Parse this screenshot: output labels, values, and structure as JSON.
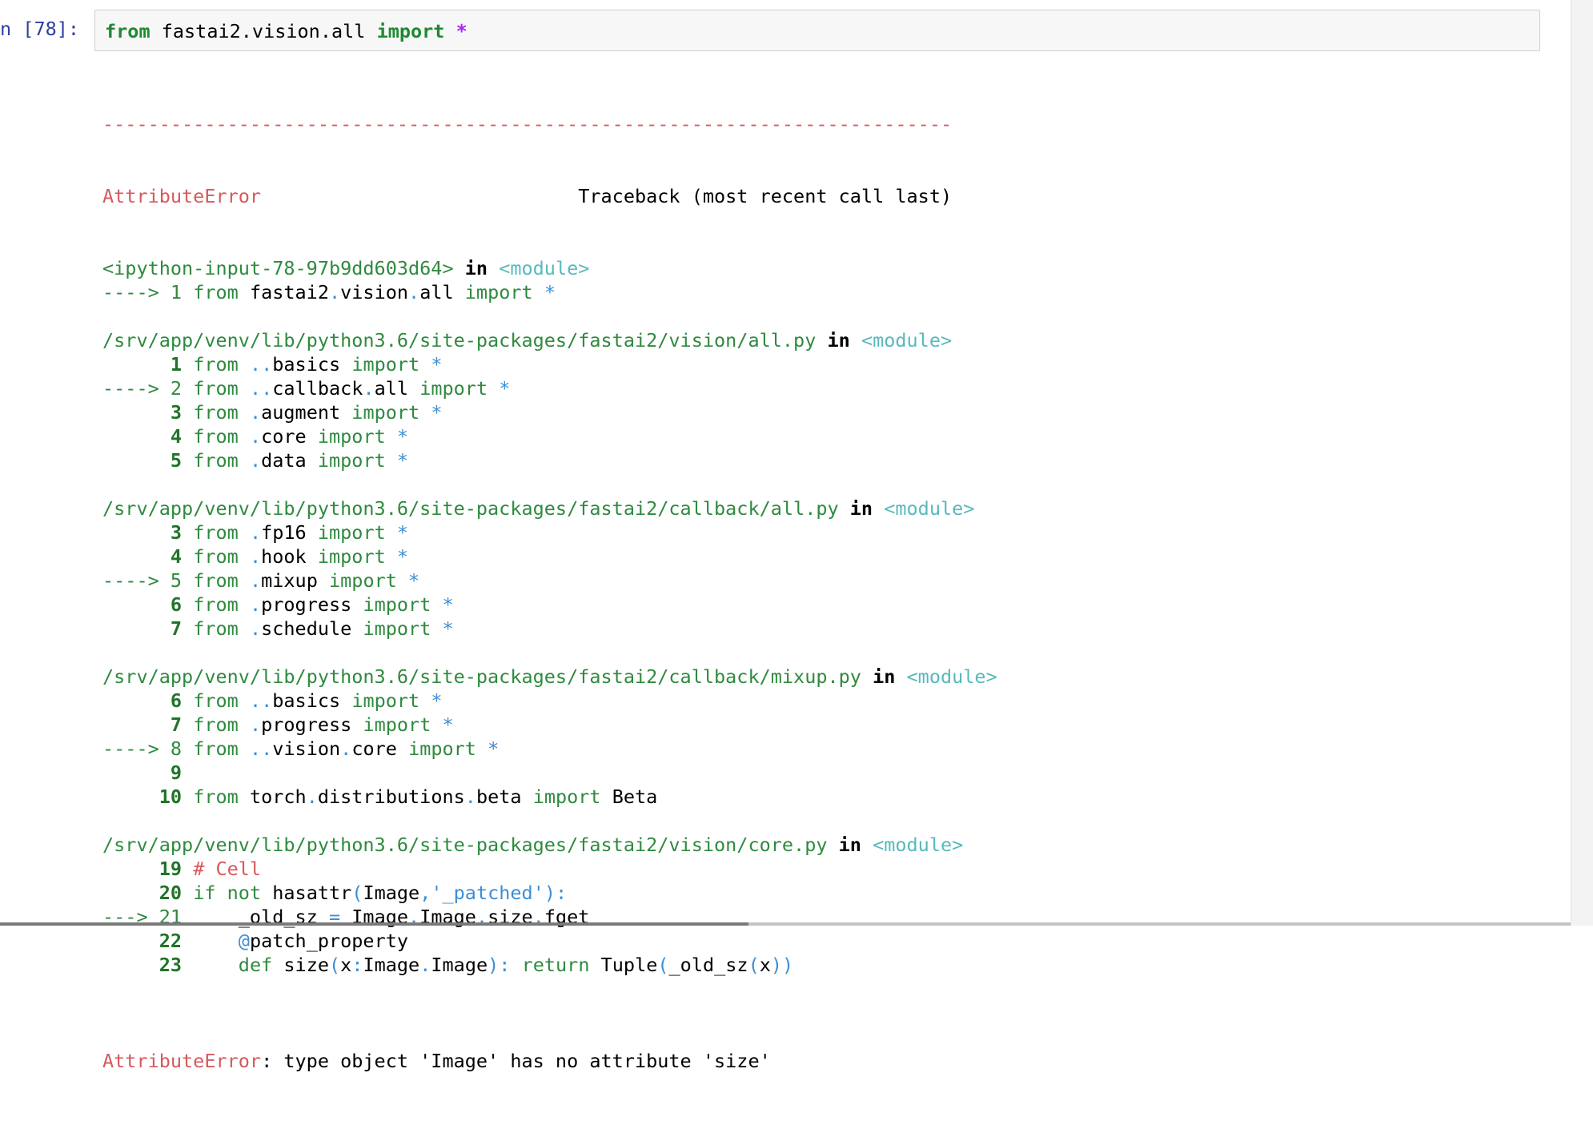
{
  "prompt": "n [78]:",
  "input": {
    "kw_from": "from",
    "module": " fastai2.vision.all ",
    "kw_import": "import",
    "star": " *"
  },
  "traceback": {
    "separator": "---------------------------------------------------------------------------",
    "error_name": "AttributeError",
    "header_pad": "                            ",
    "header": "Traceback (most recent call last)",
    "frames": [
      {
        "file": "<ipython-input-78-97b9dd603d64>",
        "in": " in ",
        "module": "<module>",
        "lines": [
          {
            "arrow": "----> ",
            "num": "1",
            "code": " from fastai2.vision.all import *"
          }
        ]
      },
      {
        "file": "/srv/app/venv/lib/python3.6/site-packages/fastai2/vision/all.py",
        "in": " in ",
        "module": "<module>",
        "lines": [
          {
            "arrow": "      ",
            "num": "1",
            "code": " from ..basics import *"
          },
          {
            "arrow": "----> ",
            "num": "2",
            "code": " from ..callback.all import *"
          },
          {
            "arrow": "      ",
            "num": "3",
            "code": " from .augment import *"
          },
          {
            "arrow": "      ",
            "num": "4",
            "code": " from .core import *"
          },
          {
            "arrow": "      ",
            "num": "5",
            "code": " from .data import *"
          }
        ]
      },
      {
        "file": "/srv/app/venv/lib/python3.6/site-packages/fastai2/callback/all.py",
        "in": " in ",
        "module": "<module>",
        "lines": [
          {
            "arrow": "      ",
            "num": "3",
            "code": " from .fp16 import *"
          },
          {
            "arrow": "      ",
            "num": "4",
            "code": " from .hook import *"
          },
          {
            "arrow": "----> ",
            "num": "5",
            "code": " from .mixup import *"
          },
          {
            "arrow": "      ",
            "num": "6",
            "code": " from .progress import *"
          },
          {
            "arrow": "      ",
            "num": "7",
            "code": " from .schedule import *"
          }
        ]
      },
      {
        "file": "/srv/app/venv/lib/python3.6/site-packages/fastai2/callback/mixup.py",
        "in": " in ",
        "module": "<module>",
        "lines": [
          {
            "arrow": "      ",
            "num": "6",
            "code": " from ..basics import *"
          },
          {
            "arrow": "      ",
            "num": "7",
            "code": " from .progress import *"
          },
          {
            "arrow": "----> ",
            "num": "8",
            "code": " from ..vision.core import *"
          },
          {
            "arrow": "      ",
            "num": "9",
            "code": ""
          },
          {
            "arrow": "     ",
            "num": "10",
            "code": " from torch.distributions.beta import Beta"
          }
        ]
      },
      {
        "file": "/srv/app/venv/lib/python3.6/site-packages/fastai2/vision/core.py",
        "in": " in ",
        "module": "<module>",
        "lines": [
          {
            "arrow": "     ",
            "num": "19",
            "code": " # Cell"
          },
          {
            "arrow": "     ",
            "num": "20",
            "code": " if not hasattr(Image,'_patched'):"
          },
          {
            "arrow": "---> ",
            "num": "21",
            "code": "     _old_sz = Image.Image.size.fget"
          },
          {
            "arrow": "     ",
            "num": "22",
            "code": "     @patch_property"
          },
          {
            "arrow": "     ",
            "num": "23",
            "code": "     def size(x:Image.Image): return Tuple(_old_sz(x))"
          }
        ]
      }
    ],
    "final_error_name": "AttributeError",
    "final_error_msg": ": type object 'Image' has no attribute 'size'"
  }
}
